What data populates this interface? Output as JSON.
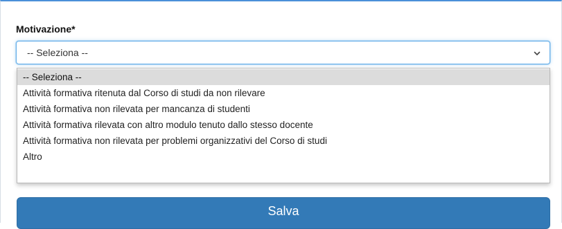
{
  "form": {
    "field_label": "Motivazione*",
    "select_value": "-- Seleziona --",
    "options": [
      "-- Seleziona --",
      "Attività formativa ritenuta dal Corso di studi da non rilevare",
      "Attività formativa non rilevata per mancanza di studenti",
      "Attività formativa rilevata con altro modulo tenuto dallo stesso docente",
      "Attività formativa non rilevata per problemi organizzativi del Corso di studi",
      "Altro"
    ],
    "selected_option_index": 0,
    "save_label": "Salva"
  },
  "icons": {
    "select_arrow": "chevron-down-icon"
  },
  "colors": {
    "primary_button": "#337ab7",
    "focus_border": "#66afe9",
    "selected_option_bg": "#dcdcdc",
    "top_border_accent": "#4a90d9"
  }
}
